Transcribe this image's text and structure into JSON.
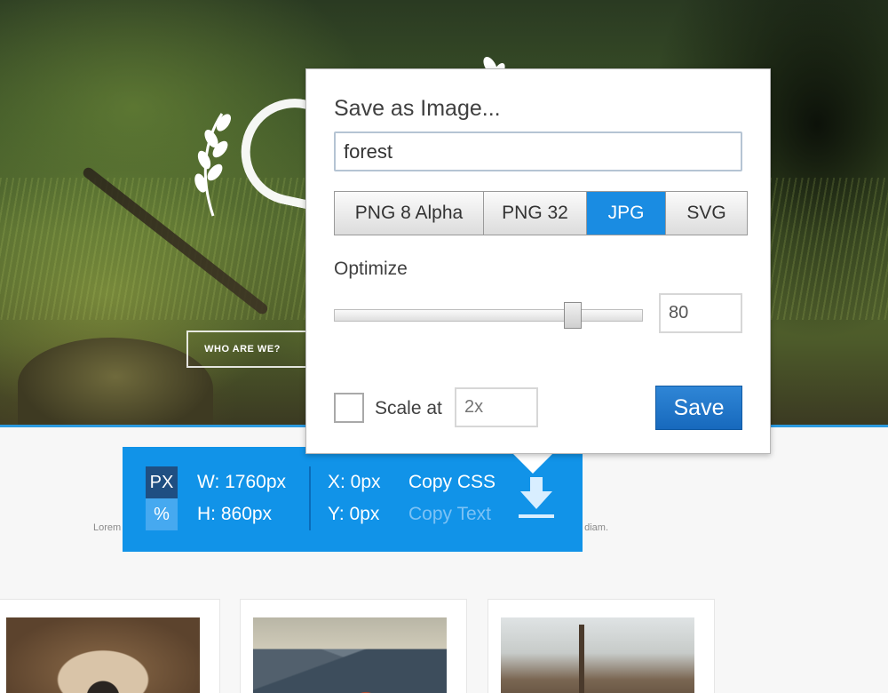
{
  "hero": {
    "button_label": "WHO ARE WE?"
  },
  "content": {
    "lorem_left": "Lorem",
    "lorem_right": "t diam."
  },
  "measure": {
    "unit_px": "PX",
    "unit_percent": "%",
    "width": "W: 1760px",
    "height": "H: 860px",
    "x": "X: 0px",
    "y": "Y: 0px",
    "copy_css": "Copy CSS",
    "copy_text": "Copy Text",
    "icons": {
      "download": "download-icon"
    }
  },
  "dialog": {
    "title": "Save as Image...",
    "filename": "forest",
    "formats": [
      "PNG 8 Alpha",
      "PNG 32",
      "JPG",
      "SVG"
    ],
    "selected_format": "JPG",
    "optimize_label": "Optimize",
    "optimize_value": "80",
    "scale_label": "Scale at",
    "scale_placeholder": "2x",
    "scale_checked": false,
    "save_label": "Save"
  },
  "colors": {
    "accent": "#1193e8",
    "save_button": "#2277cc",
    "selected_format": "#1a8ce2",
    "unit_px_active": "#1f4f82"
  }
}
